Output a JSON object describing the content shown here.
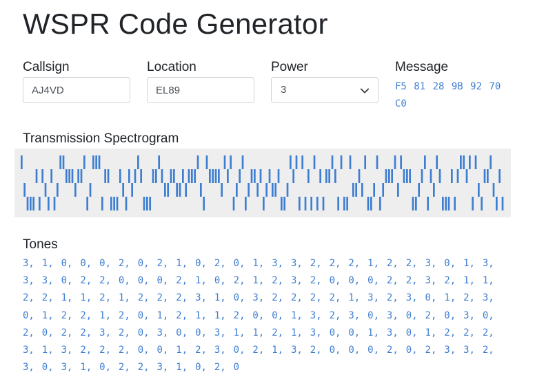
{
  "page": {
    "title": "WSPR Code Generator"
  },
  "form": {
    "callsign": {
      "label": "Callsign",
      "value": "AJ4VD"
    },
    "location": {
      "label": "Location",
      "value": "EL89"
    },
    "power": {
      "label": "Power",
      "value": "3"
    },
    "message": {
      "label": "Message",
      "value": "F5 81 28 9B 92 70 C0"
    }
  },
  "spectrogram": {
    "label": "Transmission Spectrogram",
    "bar_color": "#3e7ed1",
    "background_color": "#eeeeee"
  },
  "tones": {
    "label": "Tones",
    "values": [
      3,
      1,
      0,
      0,
      0,
      2,
      0,
      2,
      1,
      0,
      2,
      0,
      1,
      3,
      3,
      2,
      2,
      2,
      1,
      2,
      2,
      3,
      0,
      1,
      3,
      3,
      3,
      0,
      2,
      2,
      0,
      0,
      0,
      2,
      1,
      0,
      2,
      1,
      2,
      3,
      2,
      0,
      0,
      0,
      2,
      2,
      3,
      2,
      1,
      1,
      2,
      2,
      1,
      1,
      2,
      1,
      2,
      2,
      2,
      3,
      1,
      0,
      3,
      2,
      2,
      2,
      2,
      1,
      3,
      2,
      3,
      0,
      1,
      2,
      3,
      0,
      1,
      2,
      2,
      1,
      2,
      0,
      1,
      2,
      1,
      1,
      2,
      0,
      0,
      1,
      3,
      2,
      3,
      0,
      3,
      0,
      2,
      0,
      3,
      0,
      2,
      0,
      2,
      2,
      3,
      2,
      0,
      3,
      0,
      0,
      3,
      1,
      1,
      2,
      1,
      3,
      0,
      0,
      1,
      3,
      0,
      1,
      2,
      2,
      2,
      3,
      1,
      3,
      2,
      2,
      2,
      0,
      0,
      1,
      2,
      3,
      0,
      2,
      1,
      3,
      2,
      0,
      0,
      0,
      2,
      0,
      2,
      3,
      3,
      2,
      3,
      0,
      3,
      1,
      0,
      2,
      2,
      3,
      1,
      0,
      2,
      0
    ],
    "text": "3, 1, 0, 0, 0, 2, 0, 2, 1, 0, 2, 0, 1, 3, 3, 2, 2, 2, 1, 2, 2, 3, 0, 1, 3, 3, 3, 0, 2, 2, 0, 0, 0, 2, 1, 0, 2, 1, 2, 3, 2, 0, 0, 0, 2, 2, 3, 2, 1, 1, 2, 2, 1, 1, 2, 1, 2, 2, 2, 3, 1, 0, 3, 2, 2, 2, 2, 1, 3, 2, 3, 0, 1, 2, 3, 0, 1, 2, 2, 1, 2, 0, 1, 2, 1, 1, 2, 0, 0, 1, 3, 2, 3, 0, 3, 0, 2, 0, 3, 0, 2, 0, 2, 2, 3, 2, 0, 3, 0, 0, 3, 1, 1, 2, 1, 3, 0, 0, 1, 3, 0, 1, 2, 2, 2, 3, 1, 3, 2, 2, 2, 0, 0, 1, 2, 3, 0, 2, 1, 3, 2, 0, 0, 0, 2, 0, 2, 3, 3, 2, 3, 0, 3, 1, 0, 2, 2, 3, 1, 0, 2, 0"
  }
}
